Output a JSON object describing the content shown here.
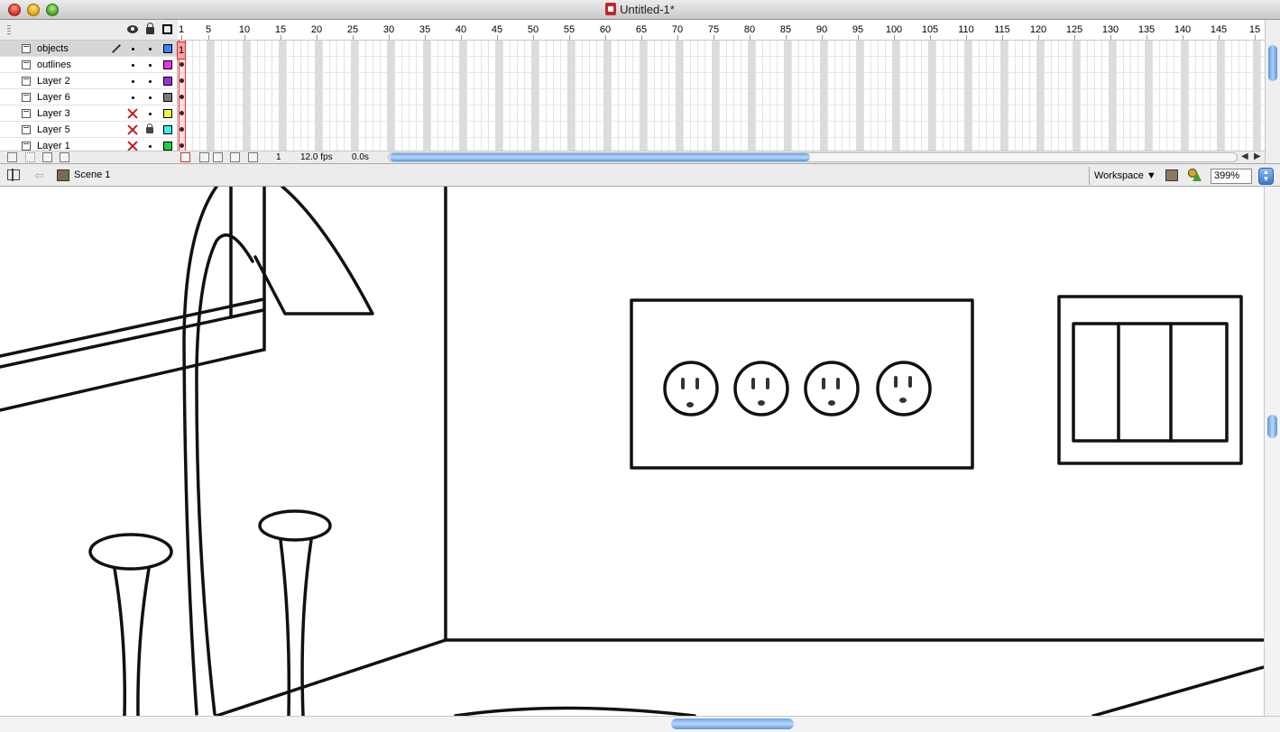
{
  "window": {
    "title": "Untitled-1*"
  },
  "timeline": {
    "layers": [
      {
        "name": "objects",
        "color": "#3b82f6",
        "active": true,
        "hidden": false,
        "locked": false
      },
      {
        "name": "outlines",
        "color": "#ee2ee8",
        "active": false,
        "hidden": false,
        "locked": false
      },
      {
        "name": "Layer 2",
        "color": "#9b30d8",
        "active": false,
        "hidden": false,
        "locked": false
      },
      {
        "name": "Layer 6",
        "color": "#7a7a7a",
        "active": false,
        "hidden": false,
        "locked": false
      },
      {
        "name": "Layer 3",
        "color": "#f7f73a",
        "active": false,
        "hidden": true,
        "locked": false
      },
      {
        "name": "Layer 5",
        "color": "#3ef0f0",
        "active": false,
        "hidden": true,
        "locked": true
      },
      {
        "name": "Layer 1",
        "color": "#22cc44",
        "active": false,
        "hidden": true,
        "locked": false
      }
    ],
    "ruler": [
      "1",
      "5",
      "10",
      "15",
      "20",
      "25",
      "30",
      "35",
      "40",
      "45",
      "50",
      "55",
      "60",
      "65",
      "70",
      "75",
      "80",
      "85",
      "90",
      "95",
      "100",
      "105",
      "110",
      "115",
      "120",
      "125",
      "130",
      "135",
      "140",
      "145",
      "15"
    ],
    "current_frame": "1",
    "frame_rate": "12.0 fps",
    "elapsed": "0.0s",
    "current_frame_indicator": "1"
  },
  "editbar": {
    "scene": "Scene 1",
    "workspace": "Workspace",
    "zoom": "399%"
  }
}
